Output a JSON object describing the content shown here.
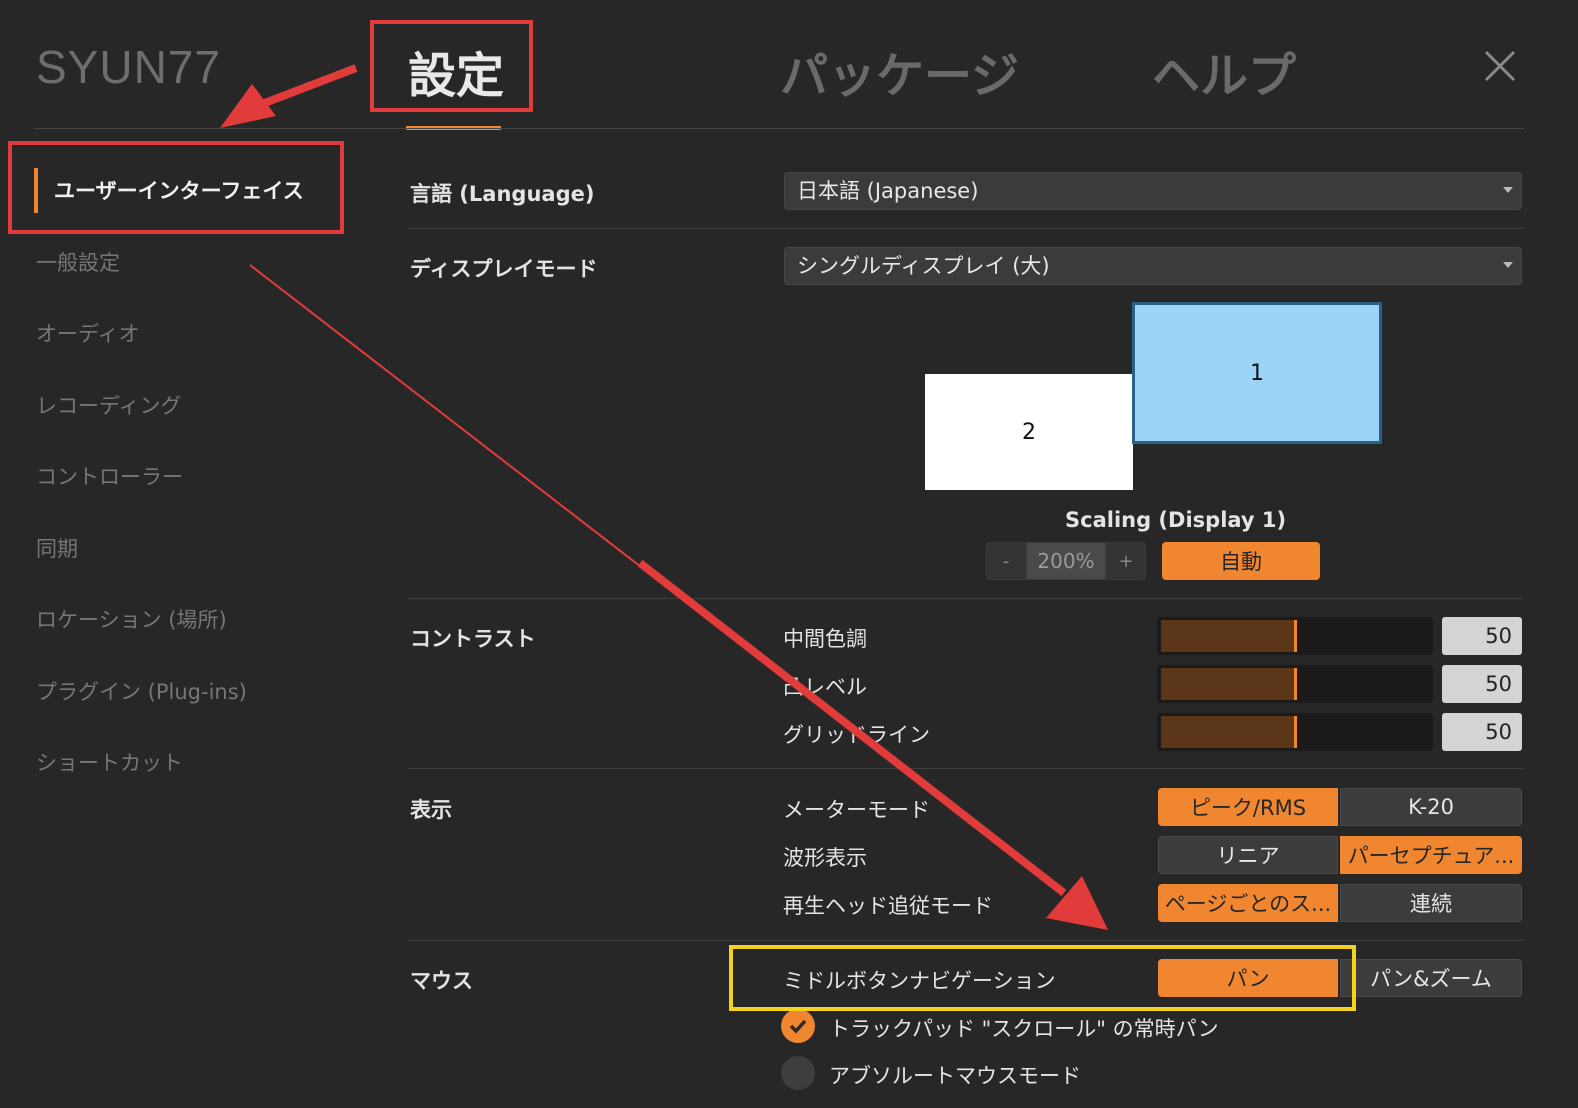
{
  "header": {
    "user": "SYUN77",
    "tabs": [
      {
        "label": "設定",
        "active": true
      },
      {
        "label": "パッケージ",
        "active": false
      },
      {
        "label": "ヘルプ",
        "active": false
      }
    ]
  },
  "sidebar": {
    "items": [
      {
        "label": "ユーザーインターフェイス",
        "active": true
      },
      {
        "label": "一般設定"
      },
      {
        "label": "オーディオ"
      },
      {
        "label": "レコーディング"
      },
      {
        "label": "コントローラー"
      },
      {
        "label": "同期"
      },
      {
        "label": "ロケーション (場所)"
      },
      {
        "label": "プラグイン (Plug-ins)"
      },
      {
        "label": "ショートカット"
      }
    ]
  },
  "language": {
    "label": "言語 (Language)",
    "value": "日本語 (Japanese)"
  },
  "display_mode": {
    "label": "ディスプレイモード",
    "value": "シングルディスプレイ (大)",
    "display1": "1",
    "display2": "2",
    "scaling_label": "Scaling (Display 1)",
    "minus": "-",
    "scale_value": "200%",
    "plus": "+",
    "auto": "自動"
  },
  "contrast": {
    "label": "コントラスト",
    "rows": [
      {
        "label": "中間色調",
        "value": "50",
        "fraction": 0.5
      },
      {
        "label": "凸レベル",
        "value": "50",
        "fraction": 0.5
      },
      {
        "label": "グリッドライン",
        "value": "50",
        "fraction": 0.5
      }
    ]
  },
  "view": {
    "label": "表示",
    "meter_mode": {
      "label": "メーターモード",
      "options": [
        "ピーク/RMS",
        "K-20"
      ],
      "selected": 0
    },
    "waveform": {
      "label": "波形表示",
      "options": [
        "リニア",
        "パーセプチュア..."
      ],
      "selected": 1
    },
    "playhead": {
      "label": "再生ヘッド追従モード",
      "options": [
        "ページごとのス...",
        "連続"
      ],
      "selected": 0
    }
  },
  "mouse": {
    "label": "マウス",
    "middle_button": {
      "label": "ミドルボタンナビゲーション",
      "options": [
        "パン",
        "パン&ズーム"
      ],
      "selected": 0
    },
    "trackpad": {
      "label": "トラックパッド \"スクロール\" の常時パン",
      "checked": true
    },
    "absolute": {
      "label": "アブソルートマウスモード",
      "checked": false
    }
  },
  "colors": {
    "accent": "#f0862f",
    "annotation_red": "#e23b3b",
    "annotation_yellow": "#f5d21e",
    "display1": "#9cd4f8"
  }
}
